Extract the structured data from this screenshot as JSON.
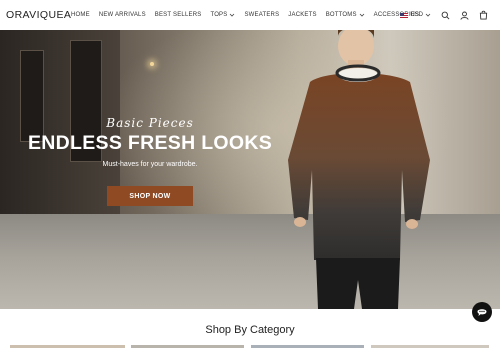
{
  "header": {
    "brand": "ORAVIQUEA",
    "nav": [
      {
        "label": "HOME",
        "dropdown": false
      },
      {
        "label": "NEW ARRIVALS",
        "dropdown": false
      },
      {
        "label": "BEST SELLERS",
        "dropdown": false
      },
      {
        "label": "TOPS",
        "dropdown": true
      },
      {
        "label": "SWEATERS",
        "dropdown": false
      },
      {
        "label": "JACKETS",
        "dropdown": false
      },
      {
        "label": "BOTTOMS",
        "dropdown": true
      },
      {
        "label": "ACCESSORIES",
        "dropdown": false
      }
    ],
    "currency": "USD",
    "icons": [
      "search-icon",
      "account-icon",
      "cart-icon"
    ]
  },
  "hero": {
    "script_text": "Basic Pieces",
    "title": "ENDLESS FRESH LOOKS",
    "subtitle": "Must-haves for your wardrobe.",
    "cta": "SHOP NOW",
    "cta_color": "#8f4a24"
  },
  "categories": {
    "title": "Shop By Category"
  },
  "chat": {
    "icon": "chat-icon"
  }
}
